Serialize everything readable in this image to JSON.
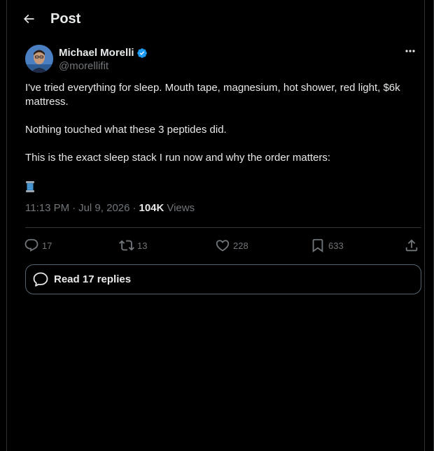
{
  "header": {
    "title": "Post",
    "back_icon": "arrow-left-icon"
  },
  "author": {
    "display_name": "Michael Morelli",
    "handle": "@morellifit",
    "verified": true,
    "verified_color": "#1d9bf0"
  },
  "post": {
    "paragraphs": [
      "I've tried everything for sleep. Mouth tape, magnesium, hot shower, red light, $6k mattress.",
      "Nothing touched what these 3 peptides did.",
      "This is the exact sleep stack I run now and why the order matters:"
    ],
    "emoji": "thread-spool-icon",
    "time": "11:13 PM",
    "date": "Jul 9, 2026",
    "views_count": "104K",
    "views_label": "Views",
    "separator": "·"
  },
  "actions": {
    "replies": "17",
    "reposts": "13",
    "likes": "228",
    "bookmarks": "633"
  },
  "read_replies_label": "Read 17 replies",
  "colors": {
    "background": "#000000",
    "text": "#e7e9ea",
    "muted": "#71767b",
    "border": "#2f3336",
    "accent": "#1d9bf0"
  }
}
